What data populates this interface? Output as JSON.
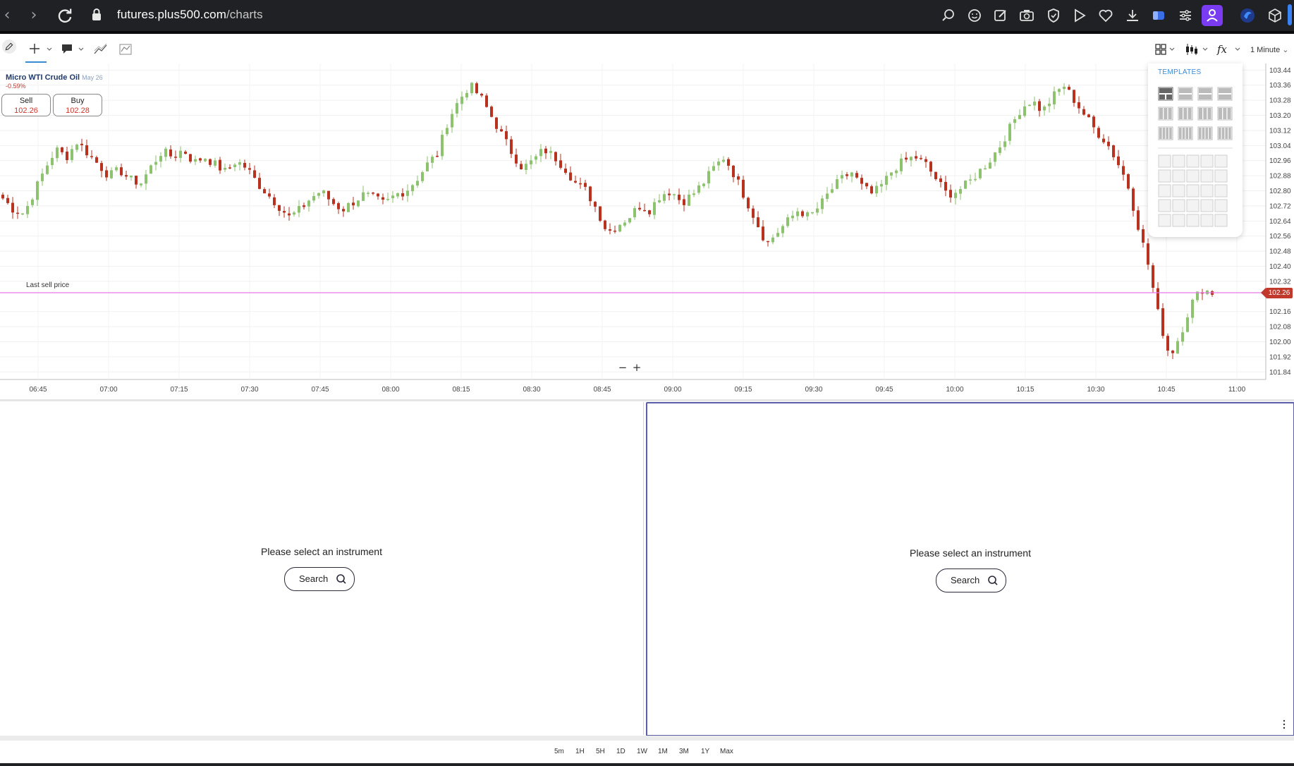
{
  "browser": {
    "url_host": "futures.plus500.com",
    "url_path": "/charts",
    "icons": [
      "back-icon",
      "forward-icon",
      "reload-icon",
      "lock-icon",
      "zoom-icon",
      "emoji-icon",
      "edit-icon",
      "camera-icon",
      "shield-icon",
      "play-icon",
      "heart-icon",
      "download-icon",
      "sidebar-icon",
      "menu-icon",
      "profile-icon",
      "extension-icon",
      "cube-icon"
    ]
  },
  "toolbar": {
    "interval": "1 Minute",
    "tools": [
      "pencil-icon",
      "crosshair-icon",
      "comment-icon",
      "trend-icon",
      "indicator-icon",
      "layout-icon",
      "candles-icon",
      "fx-icon"
    ]
  },
  "instrument": {
    "name": "Micro WTI Crude Oil",
    "contract": "May 26",
    "change": "-0.59%",
    "sell_label": "Sell",
    "sell_price": "102.26",
    "buy_label": "Buy",
    "buy_price": "102.28"
  },
  "chart": {
    "last_sell_label": "Last sell price",
    "last_price_tag": "102.26",
    "zoom_out": "−",
    "zoom_in": "+",
    "colors": {
      "up": "#8dc26e",
      "down": "#b8321f",
      "last_line": "#e879e8"
    }
  },
  "chart_data": {
    "type": "candlestick",
    "x_ticks": [
      "06:45",
      "07:00",
      "07:15",
      "07:30",
      "07:45",
      "08:00",
      "08:15",
      "08:30",
      "08:45",
      "09:00",
      "09:15",
      "09:30",
      "09:45",
      "10:00",
      "10:15",
      "10:30",
      "10:45",
      "11:00"
    ],
    "y_ticks": [
      "103.44",
      "103.36",
      "103.28",
      "103.20",
      "103.12",
      "103.04",
      "102.96",
      "102.88",
      "102.80",
      "102.72",
      "102.64",
      "102.56",
      "102.48",
      "102.40",
      "102.32",
      "102.16",
      "102.08",
      "102.00",
      "101.92",
      "101.84"
    ],
    "y_range": [
      101.8,
      103.46
    ],
    "last_price": 102.26,
    "grid": true,
    "closes": [
      102.76,
      102.7,
      102.68,
      102.8,
      102.92,
      103.02,
      102.98,
      103.06,
      103.0,
      102.94,
      102.88,
      102.91,
      102.86,
      102.84,
      102.93,
      103.01,
      102.98,
      103.02,
      102.95,
      102.98,
      102.94,
      102.9,
      102.96,
      102.92,
      102.84,
      102.78,
      102.72,
      102.66,
      102.7,
      102.76,
      102.8,
      102.74,
      102.7,
      102.74,
      102.78,
      102.76,
      102.73,
      102.78,
      102.8,
      102.86,
      102.94,
      103.0,
      103.18,
      103.28,
      103.36,
      103.3,
      103.2,
      103.1,
      103.0,
      102.92,
      102.96,
      103.02,
      102.98,
      102.92,
      102.84,
      102.8,
      102.7,
      102.58,
      102.62,
      102.66,
      102.72,
      102.7,
      102.78,
      102.8,
      102.74,
      102.78,
      102.84,
      102.92,
      102.98,
      102.88,
      102.76,
      102.64,
      102.52,
      102.58,
      102.64,
      102.7,
      102.66,
      102.72,
      102.8,
      102.86,
      102.9,
      102.82,
      102.78,
      102.84,
      102.92,
      102.96,
      102.98,
      102.94,
      102.86,
      102.78,
      102.8,
      102.84,
      102.9,
      102.96,
      103.04,
      103.14,
      103.24,
      103.28,
      103.22,
      103.3,
      103.36,
      103.28,
      103.2,
      103.12,
      103.06,
      102.96,
      102.84,
      102.62,
      102.4,
      102.12,
      101.92,
      102.04,
      102.2,
      102.28,
      102.26
    ]
  },
  "templates": {
    "title": "TEMPLATES"
  },
  "panels": {
    "left": {
      "message": "Please select an instrument",
      "search_label": "Search"
    },
    "right": {
      "message": "Please select an instrument",
      "search_label": "Search"
    }
  },
  "ranges": [
    "5m",
    "1H",
    "5H",
    "1D",
    "1W",
    "1M",
    "3M",
    "1Y",
    "Max"
  ]
}
